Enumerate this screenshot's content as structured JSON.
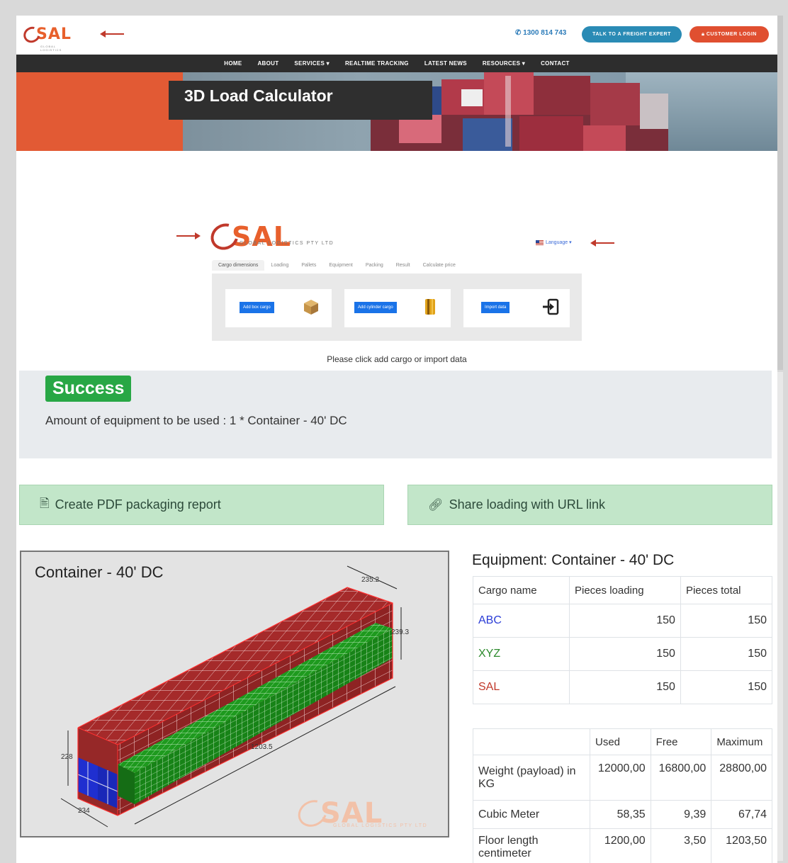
{
  "header": {
    "logo_text": "SAL",
    "logo_sub": "GLOBAL LOGISTICS",
    "phone": "1300 814 743",
    "talk_button": "TALK TO A FREIGHT EXPERT",
    "login_button": "CUSTOMER LOGIN"
  },
  "nav": {
    "items": [
      "HOME",
      "ABOUT",
      "SERVICES ▾",
      "REALTIME TRACKING",
      "LATEST NEWS",
      "RESOURCES ▾",
      "CONTACT"
    ]
  },
  "hero": {
    "title": "3D Load Calculator"
  },
  "calculator": {
    "logo_text": "SAL",
    "logo_sub": "GLOBAL LOGISTICS PTY LTD",
    "language": "Language ▾",
    "tabs": [
      "Cargo dimensions",
      "Loading",
      "Pallets",
      "Equipment",
      "Packing",
      "Result",
      "Calculate price"
    ],
    "add_box_button": "Add box cargo",
    "add_cylinder_button": "Add cylinder cargo",
    "import_button": "Import data",
    "hint": "Please click add cargo or import data"
  },
  "result": {
    "badge": "Success",
    "amount": "Amount of equipment to be used : 1 * Container - 40' DC"
  },
  "actions": {
    "pdf": "Create PDF packaging report",
    "share": "Share loading with URL link"
  },
  "viewer": {
    "title": "Container - 40' DC",
    "dims": {
      "width_top": "235.2",
      "height_right": "239.3",
      "length": "1203.5",
      "height_left": "228",
      "width_bottom": "234"
    },
    "watermark": "SAL",
    "watermark_sub": "GLOBAL LOGISTICS PTY LTD"
  },
  "equipment": {
    "title": "Equipment: Container - 40' DC",
    "cargo_headers": [
      "Cargo name",
      "Pieces loading",
      "Pieces total"
    ],
    "cargo_rows": [
      {
        "name": "ABC",
        "loading": "150",
        "total": "150",
        "color": "#2a3cd6"
      },
      {
        "name": "XYZ",
        "loading": "150",
        "total": "150",
        "color": "#2e8b2e"
      },
      {
        "name": "SAL",
        "loading": "150",
        "total": "150",
        "color": "#c0392b"
      }
    ],
    "stats_headers": [
      "",
      "Used",
      "Free",
      "Maximum"
    ],
    "stats_rows": [
      {
        "label": "Weight (payload) in KG",
        "used": "12000,00",
        "free": "16800,00",
        "max": "28800,00"
      },
      {
        "label": "Cubic Meter",
        "used": "58,35",
        "free": "9,39",
        "max": "67,74"
      },
      {
        "label": "Floor length centimeter",
        "used": "1200,00",
        "free": "3,50",
        "max": "1203,50"
      }
    ]
  }
}
